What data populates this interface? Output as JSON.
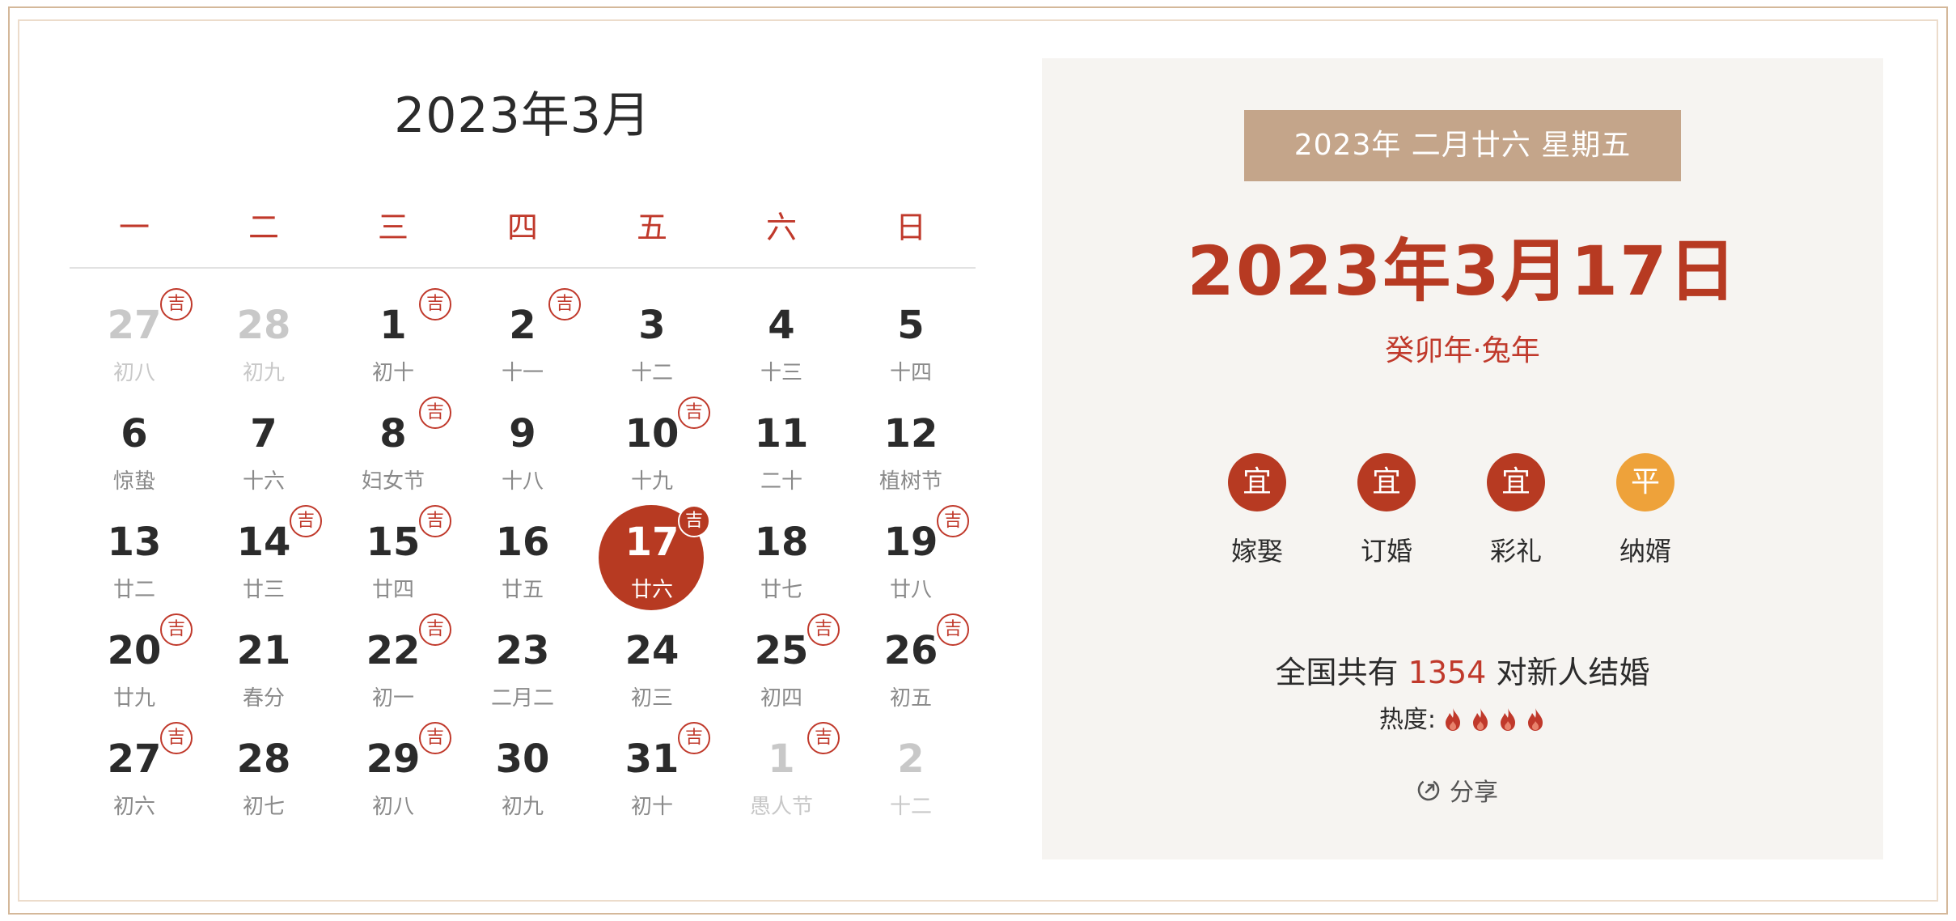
{
  "calendar": {
    "title": "2023年3月",
    "weekdays": [
      "一",
      "二",
      "三",
      "四",
      "五",
      "六",
      "日"
    ],
    "weeks": [
      [
        {
          "day": "27",
          "lunar": "初八",
          "ji": true,
          "other": true
        },
        {
          "day": "28",
          "lunar": "初九",
          "ji": false,
          "other": true
        },
        {
          "day": "1",
          "lunar": "初十",
          "ji": true,
          "other": false
        },
        {
          "day": "2",
          "lunar": "十一",
          "ji": true,
          "other": false
        },
        {
          "day": "3",
          "lunar": "十二",
          "ji": false,
          "other": false
        },
        {
          "day": "4",
          "lunar": "十三",
          "ji": false,
          "other": false
        },
        {
          "day": "5",
          "lunar": "十四",
          "ji": false,
          "other": false
        }
      ],
      [
        {
          "day": "6",
          "lunar": "惊蛰",
          "ji": false,
          "other": false
        },
        {
          "day": "7",
          "lunar": "十六",
          "ji": false,
          "other": false
        },
        {
          "day": "8",
          "lunar": "妇女节",
          "ji": true,
          "other": false
        },
        {
          "day": "9",
          "lunar": "十八",
          "ji": false,
          "other": false
        },
        {
          "day": "10",
          "lunar": "十九",
          "ji": true,
          "other": false
        },
        {
          "day": "11",
          "lunar": "二十",
          "ji": false,
          "other": false
        },
        {
          "day": "12",
          "lunar": "植树节",
          "ji": false,
          "other": false
        }
      ],
      [
        {
          "day": "13",
          "lunar": "廿二",
          "ji": false,
          "other": false
        },
        {
          "day": "14",
          "lunar": "廿三",
          "ji": true,
          "other": false
        },
        {
          "day": "15",
          "lunar": "廿四",
          "ji": true,
          "other": false
        },
        {
          "day": "16",
          "lunar": "廿五",
          "ji": false,
          "other": false
        },
        {
          "day": "17",
          "lunar": "廿六",
          "ji": true,
          "other": false,
          "selected": true
        },
        {
          "day": "18",
          "lunar": "廿七",
          "ji": false,
          "other": false
        },
        {
          "day": "19",
          "lunar": "廿八",
          "ji": true,
          "other": false
        }
      ],
      [
        {
          "day": "20",
          "lunar": "廿九",
          "ji": true,
          "other": false
        },
        {
          "day": "21",
          "lunar": "春分",
          "ji": false,
          "other": false
        },
        {
          "day": "22",
          "lunar": "初一",
          "ji": true,
          "other": false
        },
        {
          "day": "23",
          "lunar": "二月二",
          "ji": false,
          "other": false
        },
        {
          "day": "24",
          "lunar": "初三",
          "ji": false,
          "other": false
        },
        {
          "day": "25",
          "lunar": "初四",
          "ji": true,
          "other": false
        },
        {
          "day": "26",
          "lunar": "初五",
          "ji": true,
          "other": false
        }
      ],
      [
        {
          "day": "27",
          "lunar": "初六",
          "ji": true,
          "other": false
        },
        {
          "day": "28",
          "lunar": "初七",
          "ji": false,
          "other": false
        },
        {
          "day": "29",
          "lunar": "初八",
          "ji": true,
          "other": false
        },
        {
          "day": "30",
          "lunar": "初九",
          "ji": false,
          "other": false
        },
        {
          "day": "31",
          "lunar": "初十",
          "ji": true,
          "other": false
        },
        {
          "day": "1",
          "lunar": "愚人节",
          "ji": true,
          "other": true
        },
        {
          "day": "2",
          "lunar": "十二",
          "ji": false,
          "other": true
        }
      ]
    ],
    "ji_label": "吉"
  },
  "detail": {
    "banner": "2023年  二月廿六  星期五",
    "date": "2023年3月17日",
    "zodiac": "癸卯年·兔年",
    "activities": [
      {
        "badge": "宜",
        "label": "嫁娶",
        "kind": "good"
      },
      {
        "badge": "宜",
        "label": "订婚",
        "kind": "good"
      },
      {
        "badge": "宜",
        "label": "彩礼",
        "kind": "good"
      },
      {
        "badge": "平",
        "label": "纳婿",
        "kind": "neutral"
      }
    ],
    "count_prefix": "全国共有 ",
    "count_value": "1354",
    "count_suffix": " 对新人结婚",
    "heat_label": "热度:",
    "heat_level": 4,
    "share_label": "分享"
  },
  "colors": {
    "accent": "#b73a22",
    "banner": "#c4a58a",
    "neutral_badge": "#eea23a",
    "panel_bg": "#f6f4f1",
    "frame": "#d4b89a"
  },
  "icons": [
    "ji-badge-icon",
    "flame-icon",
    "share-icon"
  ]
}
